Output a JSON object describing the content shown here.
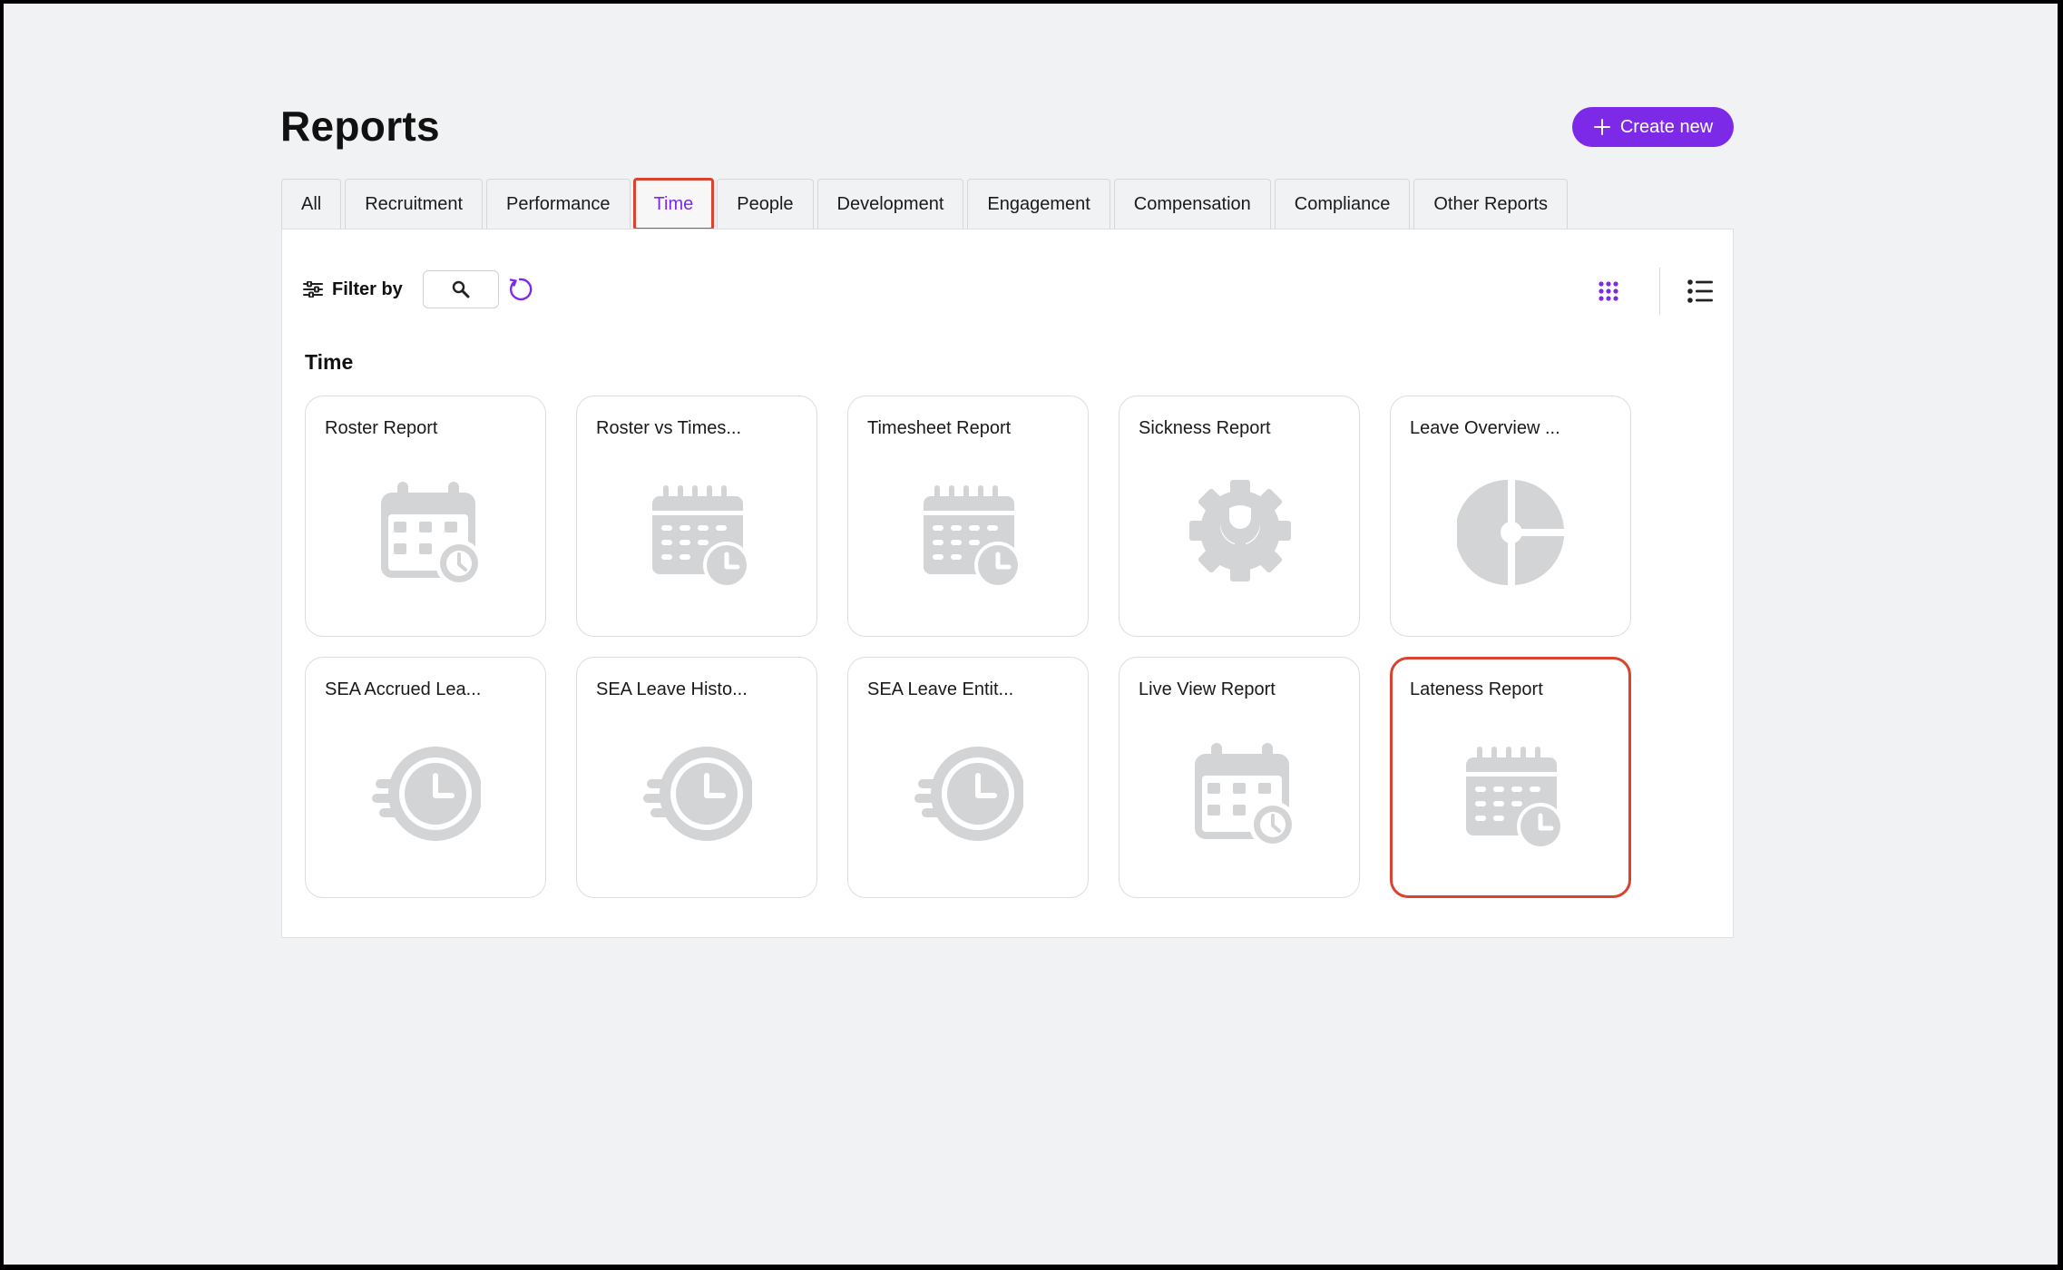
{
  "page": {
    "title": "Reports"
  },
  "actions": {
    "create_label": "Create new"
  },
  "tabs": [
    {
      "label": "All",
      "active": false
    },
    {
      "label": "Recruitment",
      "active": false
    },
    {
      "label": "Performance",
      "active": false
    },
    {
      "label": "Time",
      "active": true
    },
    {
      "label": "People",
      "active": false
    },
    {
      "label": "Development",
      "active": false
    },
    {
      "label": "Engagement",
      "active": false
    },
    {
      "label": "Compensation",
      "active": false
    },
    {
      "label": "Compliance",
      "active": false
    },
    {
      "label": "Other Reports",
      "active": false
    }
  ],
  "filter": {
    "label": "Filter by"
  },
  "section": {
    "title": "Time"
  },
  "cards": [
    {
      "title": "Roster Report",
      "icon": "calendar-clock-icon"
    },
    {
      "title": "Roster vs Times...",
      "icon": "calendar-schedule-icon"
    },
    {
      "title": "Timesheet Report",
      "icon": "calendar-schedule-icon"
    },
    {
      "title": "Sickness Report",
      "icon": "gear-wrench-icon"
    },
    {
      "title": "Leave Overview ...",
      "icon": "pie-chart-icon"
    },
    {
      "title": "SEA Accrued Lea...",
      "icon": "fast-clock-icon"
    },
    {
      "title": "SEA Leave Histo...",
      "icon": "fast-clock-icon"
    },
    {
      "title": "SEA Leave Entit...",
      "icon": "fast-clock-icon"
    },
    {
      "title": "Live View Report",
      "icon": "calendar-clock-icon"
    },
    {
      "title": "Lateness Report",
      "icon": "calendar-schedule-icon"
    }
  ],
  "colors": {
    "accent": "#7d2ae8",
    "highlight": "#d9432f",
    "icon_gray": "#d3d4d6",
    "background": "#f1f2f4"
  }
}
